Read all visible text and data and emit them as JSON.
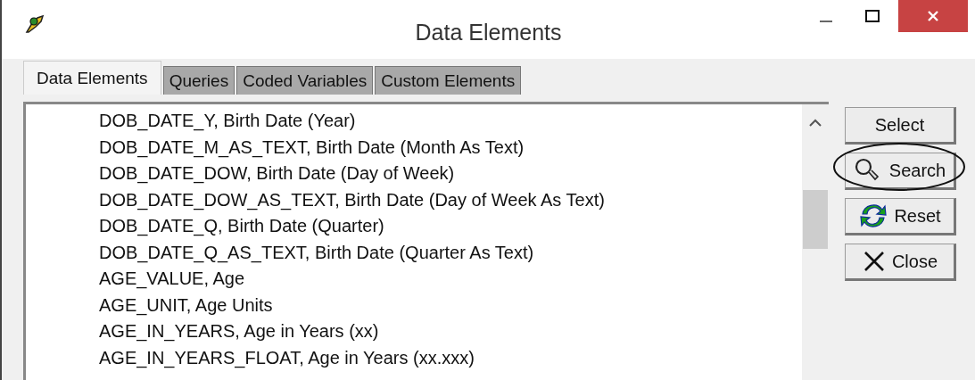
{
  "window": {
    "title": "Data Elements"
  },
  "tabs": [
    {
      "label": "Data Elements",
      "selected": true
    },
    {
      "label": "Queries",
      "selected": false
    },
    {
      "label": "Coded Variables",
      "selected": false
    },
    {
      "label": "Custom Elements",
      "selected": false
    }
  ],
  "list": {
    "items": [
      "DOB_DATE_Y, Birth Date (Year)",
      "DOB_DATE_M_AS_TEXT, Birth Date (Month As Text)",
      "DOB_DATE_DOW, Birth Date (Day of Week)",
      "DOB_DATE_DOW_AS_TEXT, Birth Date (Day of Week As Text)",
      "DOB_DATE_Q, Birth Date (Quarter)",
      "DOB_DATE_Q_AS_TEXT, Birth Date (Quarter As Text)",
      "AGE_VALUE, Age",
      "AGE_UNIT, Age Units",
      "AGE_IN_YEARS, Age in Years (xx)",
      "AGE_IN_YEARS_FLOAT, Age in Years (xx.xxx)"
    ]
  },
  "buttons": [
    {
      "kind": "select",
      "label": "Select",
      "highlighted": false
    },
    {
      "kind": "search",
      "label": "Search",
      "highlighted": true
    },
    {
      "kind": "reset",
      "label": "Reset",
      "highlighted": false
    },
    {
      "kind": "close",
      "label": "Close",
      "highlighted": false
    }
  ]
}
